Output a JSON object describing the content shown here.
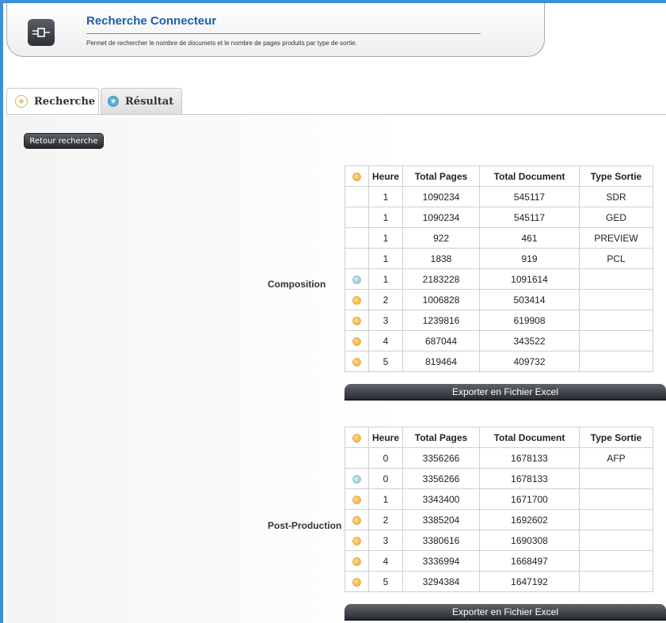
{
  "header": {
    "title": "Recherche Connecteur",
    "description": "Permet de rechercher le nombre de documets et le nombre de pages produits par type de sortie."
  },
  "tabs": [
    {
      "label": "Recherche",
      "icon": "plus-circle-icon"
    },
    {
      "label": "Résultat",
      "icon": "chevron-down-circle-icon"
    }
  ],
  "retour_button": "Retour recherche",
  "columns": [
    "Heure",
    "Total Pages",
    "Total Document",
    "Type Sortie"
  ],
  "composition": {
    "label": "Composition",
    "rows": [
      {
        "heure": "1",
        "pages": "1090234",
        "docs": "545117",
        "type": "SDR"
      },
      {
        "heure": "1",
        "pages": "1090234",
        "docs": "545117",
        "type": "GED"
      },
      {
        "heure": "1",
        "pages": "922",
        "docs": "461",
        "type": "PREVIEW"
      },
      {
        "heure": "1",
        "pages": "1838",
        "docs": "919",
        "type": "PCL"
      },
      {
        "heure": "1",
        "pages": "2183228",
        "docs": "1091614",
        "type": ""
      },
      {
        "heure": "2",
        "pages": "1006828",
        "docs": "503414",
        "type": ""
      },
      {
        "heure": "3",
        "pages": "1239816",
        "docs": "619908",
        "type": ""
      },
      {
        "heure": "4",
        "pages": "687044",
        "docs": "343522",
        "type": ""
      },
      {
        "heure": "5",
        "pages": "819464",
        "docs": "409732",
        "type": ""
      }
    ],
    "export_label": "Exporter en Fichier Excel"
  },
  "postproduction": {
    "label": "Post-Production",
    "rows": [
      {
        "heure": "0",
        "pages": "3356266",
        "docs": "1678133",
        "type": "AFP"
      },
      {
        "heure": "0",
        "pages": "3356266",
        "docs": "1678133",
        "type": ""
      },
      {
        "heure": "1",
        "pages": "3343400",
        "docs": "1671700",
        "type": ""
      },
      {
        "heure": "2",
        "pages": "3385204",
        "docs": "1692602",
        "type": ""
      },
      {
        "heure": "3",
        "pages": "3380616",
        "docs": "1690308",
        "type": ""
      },
      {
        "heure": "4",
        "pages": "3336994",
        "docs": "1668497",
        "type": ""
      },
      {
        "heure": "5",
        "pages": "3294384",
        "docs": "1647192",
        "type": ""
      }
    ],
    "export_label": "Exporter en Fichier Excel"
  }
}
